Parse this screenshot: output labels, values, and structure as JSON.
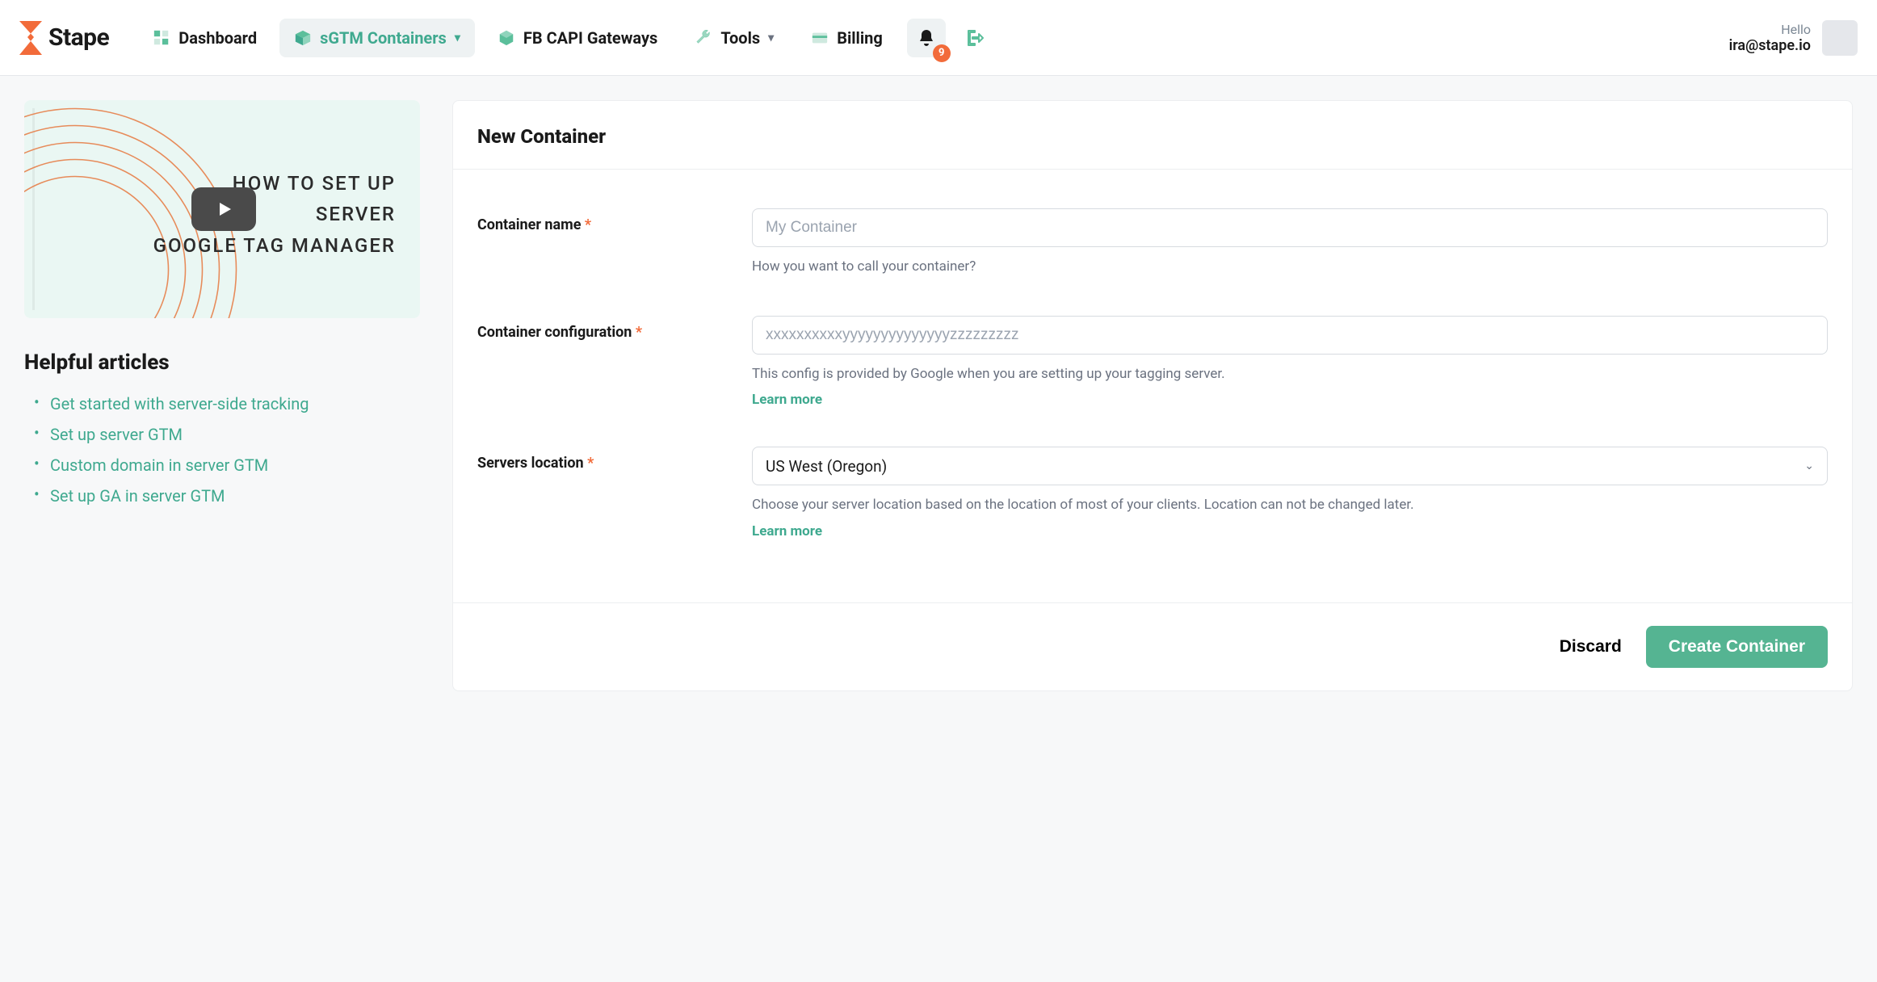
{
  "brand": "Stape",
  "nav": {
    "dashboard": "Dashboard",
    "sgtm": "sGTM Containers",
    "fbcapi": "FB CAPI Gateways",
    "tools": "Tools",
    "billing": "Billing"
  },
  "notifications": {
    "count": "9"
  },
  "user": {
    "hello": "Hello",
    "email": "ira@stape.io"
  },
  "side": {
    "video_title_line1": "HOW TO SET UP",
    "video_title_line2": "SERVER",
    "video_title_line3": "GOOGLE TAG MANAGER",
    "articles_heading": "Helpful articles",
    "articles": [
      "Get started with server-side tracking",
      "Set up server GTM",
      "Custom domain in server GTM",
      "Set up GA in server GTM"
    ]
  },
  "form": {
    "title": "New Container",
    "name": {
      "label": "Container name",
      "placeholder": "My Container",
      "hint": "How you want to call your container?"
    },
    "config": {
      "label": "Container configuration",
      "placeholder": "xxxxxxxxxxyyyyyyyyyyyyyyzzzzzzzzz",
      "hint": "This config is provided by Google when you are setting up your tagging server.",
      "learn": "Learn more"
    },
    "location": {
      "label": "Servers location",
      "value": "US West (Oregon)",
      "hint": "Choose your server location based on the location of most of your clients. Location can not be changed later.",
      "learn": "Learn more"
    },
    "discard": "Discard",
    "create": "Create Container"
  }
}
